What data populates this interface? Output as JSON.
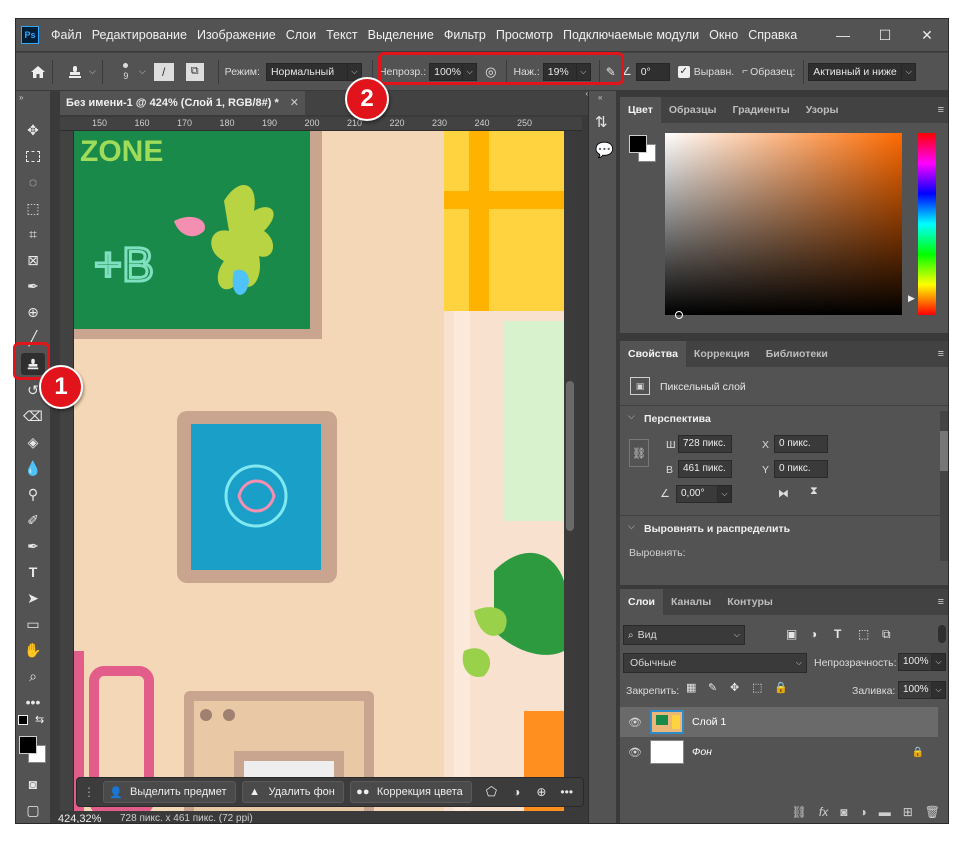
{
  "app": {
    "logo": "Ps"
  },
  "menu": [
    "Файл",
    "Редактирование",
    "Изображение",
    "Слои",
    "Текст",
    "Выделение",
    "Фильтр",
    "Просмотр",
    "Подключаемые модули",
    "Окно",
    "Справка"
  ],
  "window_controls": {
    "minimize": "—",
    "maximize": "☐",
    "close": "✕"
  },
  "options": {
    "brush_size": "9",
    "mode_label": "Режим:",
    "mode_value": "Нормальный",
    "opacity_label": "Непрозр.:",
    "opacity_value": "100%",
    "flow_label": "Наж.:",
    "flow_value": "19%",
    "angle_value": "0°",
    "aligned_label": "Выравн.",
    "sample_label": "Образец:",
    "sample_value": "Активный и ниже"
  },
  "document": {
    "tab_title": "Без имени-1 @ 424% (Слой 1, RGB/8#) *",
    "zoom": "424,32%",
    "doc_info": "728 пикс. x 461 пикс. (72 ppi)",
    "ruler_top": [
      "150",
      "160",
      "170",
      "180",
      "190",
      "200",
      "210",
      "220",
      "230",
      "240",
      "250"
    ],
    "canvas_text": "ZONE"
  },
  "context_bar": {
    "select_subject": "Выделить предмет",
    "remove_bg": "Удалить фон",
    "color_correction": "Коррекция цвета"
  },
  "color_panel": {
    "tabs": [
      "Цвет",
      "Образцы",
      "Градиенты",
      "Узоры"
    ]
  },
  "properties_panel": {
    "tabs": [
      "Свойства",
      "Коррекция",
      "Библиотеки"
    ],
    "layer_type": "Пиксельный слой",
    "section_perspective": "Перспектива",
    "w_label": "Ш",
    "w_value": "728 пикс.",
    "h_label": "В",
    "h_value": "461 пикс.",
    "x_label": "X",
    "x_value": "0 пикс.",
    "y_label": "Y",
    "y_value": "0 пикс.",
    "angle_value": "0,00°",
    "section_align": "Выровнять и распределить",
    "align_label": "Выровнять:"
  },
  "layers_panel": {
    "tabs": [
      "Слои",
      "Каналы",
      "Контуры"
    ],
    "filter": "Вид",
    "blend_mode": "Обычные",
    "opacity_label": "Непрозрачность:",
    "opacity_value": "100%",
    "lock_label": "Закрепить:",
    "fill_label": "Заливка:",
    "fill_value": "100%",
    "layers": [
      {
        "name": "Слой 1"
      },
      {
        "name": "Фон"
      }
    ]
  },
  "badges": {
    "one": "1",
    "two": "2"
  },
  "colors": {
    "highlight": "#e2141b",
    "panel": "#535353",
    "workspace": "#3a3a3a"
  }
}
